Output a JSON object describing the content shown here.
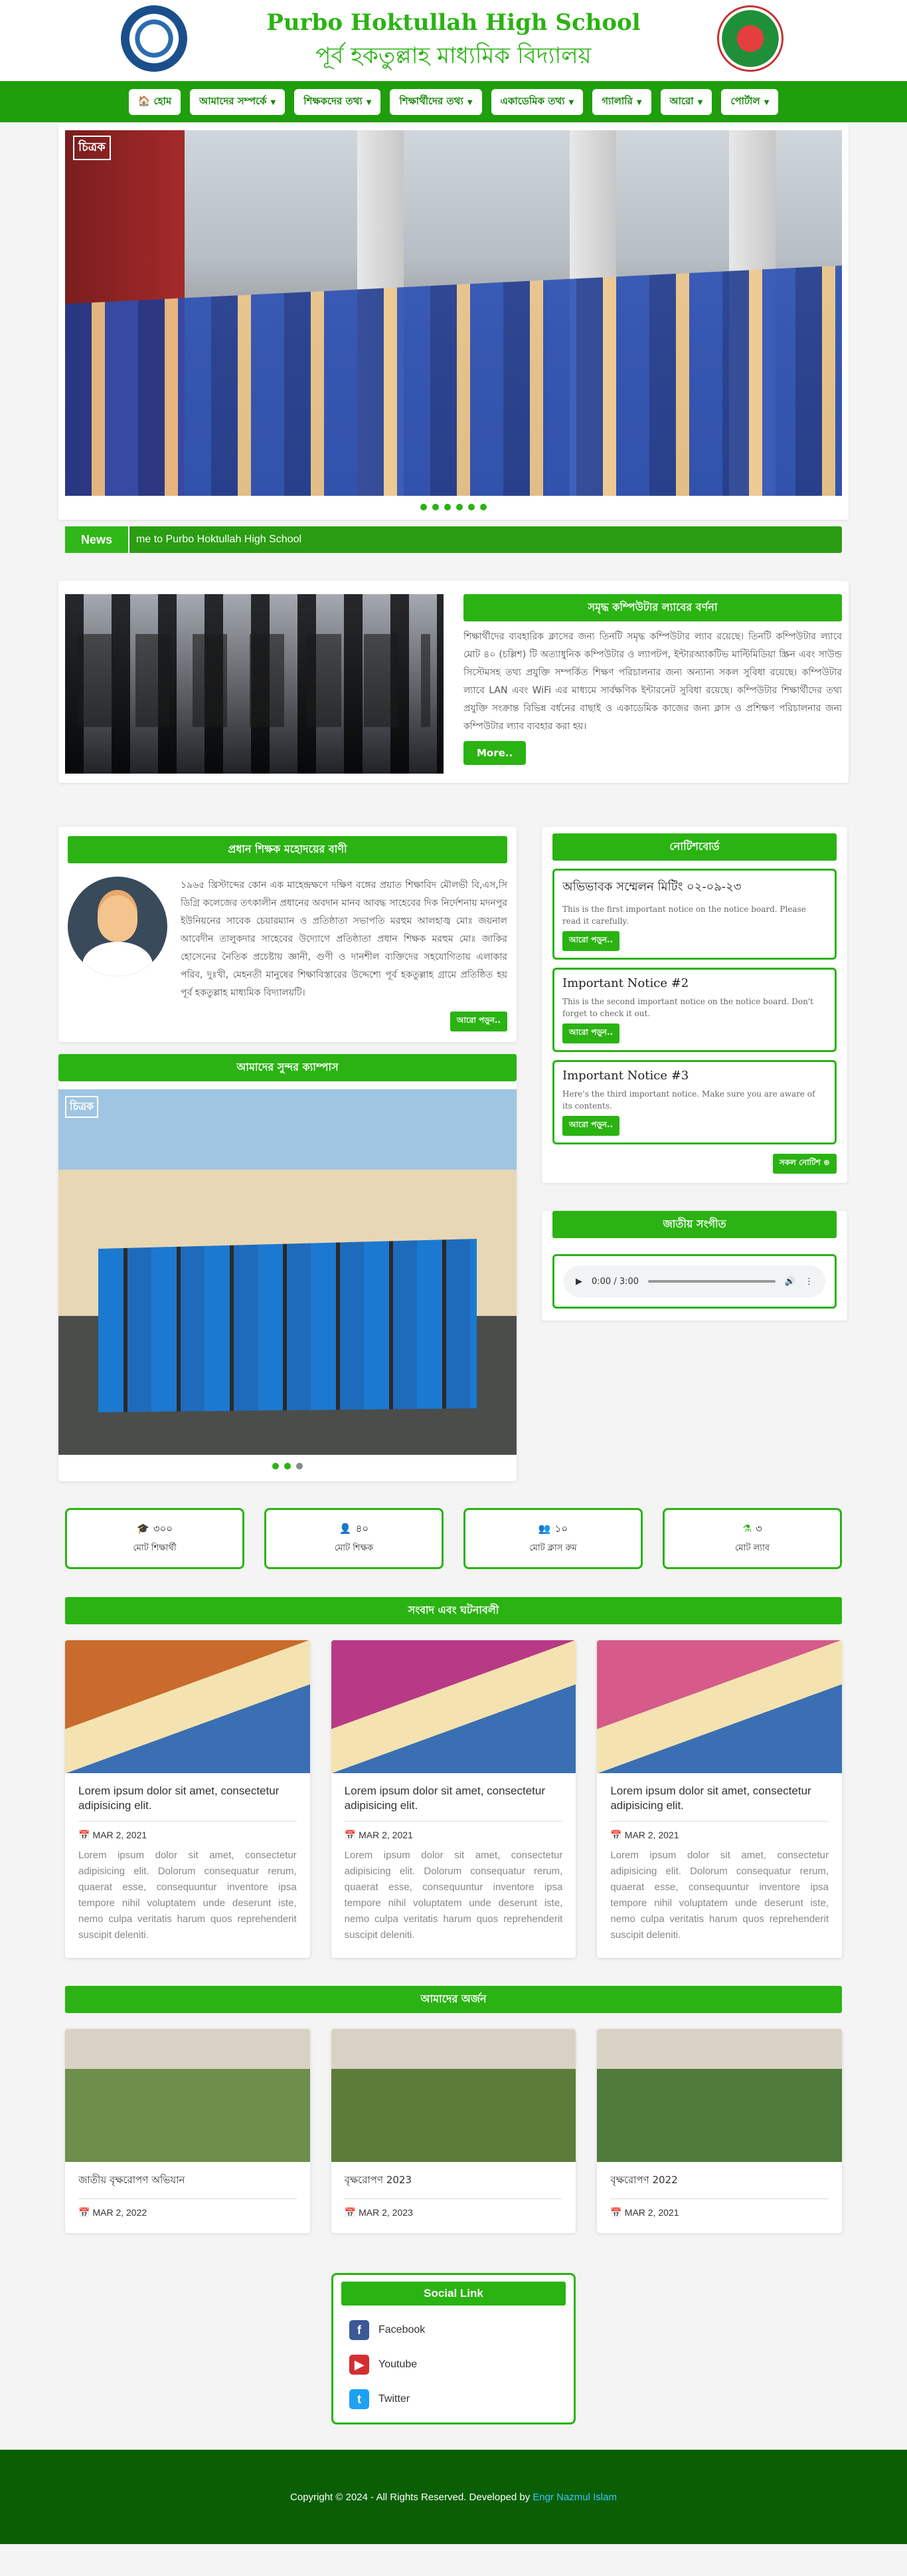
{
  "header": {
    "title_en": "Purbo Hoktullah High School",
    "title_bn": "পূর্ব হকতুল্লাহ মাধ্যমিক বিদ্যালয়"
  },
  "nav": [
    {
      "label": "🏠 হোম",
      "dropdown": false
    },
    {
      "label": "আমাদের সম্পর্কে",
      "dropdown": true
    },
    {
      "label": "শিক্ষকদের তথ্য",
      "dropdown": true
    },
    {
      "label": "শিক্ষার্থীদের তথ্য",
      "dropdown": true
    },
    {
      "label": "একাডেমিক তথ্য",
      "dropdown": true
    },
    {
      "label": "গ্যালারি",
      "dropdown": true
    },
    {
      "label": "আরো",
      "dropdown": true
    },
    {
      "label": "পোর্টাল",
      "dropdown": true
    }
  ],
  "hero": {
    "tag": "চিত্রক"
  },
  "news": {
    "label": "News",
    "text": "me to Purbo Hoktullah High School"
  },
  "lab": {
    "title": "সমৃদ্ধ কম্পিউটার ল্যাবের বর্ণনা",
    "text": "শিক্ষার্থীদের ব্যবহারিক ক্লাসের জন্য তিনটি সমৃদ্ধ কম্পিউটার ল্যাব রয়েছে। তিনটি কম্পিউটার ল্যাবে মোট ৪০ (চল্লিশ) টি অত্যাধুনিক কম্পিউটার ও ল্যাপটপ, ইন্টারঅ্যাকটিভ মাল্টিমিডিয়া স্ক্রিন এবং সাউন্ড সিস্টেমসহ তথ্য প্রযুক্তি সম্পর্কিত শিক্ষণ পরিচালনার জন্য অন্যান্য সকল সুবিধা রয়েছে। কম্পিউটার ল্যাবে LAN এবং WiFi এর মাধ্যমে সার্বক্ষণিক ইন্টারনেট সুবিধা রয়েছে। কম্পিউটার শিক্ষার্থীদের তথ্য প্রযুক্তি সংক্রান্ত বিভিন্ন বর্ধনের বাছাই ও একাডেমিক কাজের জন্য ক্লাস ও প্রশিক্ষণ পরিচালনার জন্য কম্পিউটার ল্যাব ব্যবহার করা হয়।",
    "button": "More.."
  },
  "message": {
    "title": "প্রধান শিক্ষক মহোদয়ের বাণী",
    "text": "১৯৬৫ খ্রিস্টাব্দের কোন এক মাহেন্দ্রক্ষণে দক্ষিণ বঙ্গের প্রয়াত শিক্ষাবিদ মৌলভী বি,এস,সি ডিগ্রি কলেজের তৎকালীন প্রধানের অবদান মানব আবদ্ধ সাহেবের দিক নির্দেশনায় মদনপুর ইউনিয়নের সাবেক চেয়ারম্যান ও প্রতিষ্ঠাতা সভাপতি মরহুম আলহাজ্ব মোঃ জয়নাল আবেদীন তালুকদার সাহেবের উদ্যোগে প্রতিষ্ঠাতা প্রধান শিক্ষক মরহুম মোঃ জাকির হোসেনের নৈতিক প্রচেষ্টায় জ্ঞানী, গুণী ও দানশীল ব্যক্তিদের সহযোগিতায় এলাকার পরিব, দুঃখী, মেহনতী মানুষের শিক্ষাবিস্তারের উদ্দেশ্যে পূর্ব হকতুল্লাহ গ্রামে প্রতিষ্ঠিত হয় পূর্ব হকতুল্লাহ মাধ্যমিক বিদ্যালয়টি।",
    "button": "আরো পড়ুন.."
  },
  "campus": {
    "title": "আমাদের সুন্দর ক্যাম্পাস",
    "tag": "চিত্রক"
  },
  "notice_board": {
    "title": "নোটিশবোর্ড",
    "items": [
      {
        "title": "অভিভাবক সম্মেলন মিটিং ০২-০৯-২৩",
        "desc": "This is the first important notice on the notice board. Please read it carefully.",
        "button": "আরো পড়ুন.."
      },
      {
        "title": "Important Notice #2",
        "desc": "This is the second important notice on the notice board. Don't forget to check it out.",
        "button": "আরো পড়ুন.."
      },
      {
        "title": "Important Notice #3",
        "desc": "Here's the third important notice. Make sure you are aware of its contents.",
        "button": "আরো পড়ুন.."
      }
    ],
    "all_button": "সকল নোটিশ ⊕"
  },
  "anthem": {
    "title": "জাতীয় সংগীত",
    "time": "0:00 / 3:00"
  },
  "stats": [
    {
      "icon": "🎓",
      "value": "৩০০",
      "label": "মোট শিক্ষার্থী"
    },
    {
      "icon": "👤",
      "value": "৪০",
      "label": "মোট শিক্ষক"
    },
    {
      "icon": "👥",
      "value": "১০",
      "label": "মোট ক্লাস রুম"
    },
    {
      "icon": "⚗",
      "value": "৩",
      "label": "মোট ল্যাব"
    }
  ],
  "events": {
    "title": "সংবাদ এবং ঘটনাবলী",
    "items": [
      {
        "title": "Lorem ipsum dolor sit amet, consectetur adipisicing elit.",
        "date": "MAR 2, 2021",
        "desc": "Lorem ipsum dolor sit amet, consectetur adipisicing elit. Dolorum consequatur rerum, quaerat esse, consequuntur inventore ipsa tempore nihil voluptatem unde deserunt iste, nemo culpa veritatis harum quos reprehenderit suscipit deleniti.",
        "color": "#c96b2c"
      },
      {
        "title": "Lorem ipsum dolor sit amet, consectetur adipisicing elit.",
        "date": "MAR 2, 2021",
        "desc": "Lorem ipsum dolor sit amet, consectetur adipisicing elit. Dolorum consequatur rerum, quaerat esse, consequuntur inventore ipsa tempore nihil voluptatem unde deserunt iste, nemo culpa veritatis harum quos reprehenderit suscipit deleniti.",
        "color": "#b83a86"
      },
      {
        "title": "Lorem ipsum dolor sit amet, consectetur adipisicing elit.",
        "date": "MAR 2, 2021",
        "desc": "Lorem ipsum dolor sit amet, consectetur adipisicing elit. Dolorum consequatur rerum, quaerat esse, consequuntur inventore ipsa tempore nihil voluptatem unde deserunt iste, nemo culpa veritatis harum quos reprehenderit suscipit deleniti.",
        "color": "#d65b8a"
      }
    ]
  },
  "achievements": {
    "title": "আমাদের অর্জন",
    "items": [
      {
        "title": "জাতীয় বৃক্ষরোপণ অভিযান",
        "date": "MAR 2, 2022",
        "color": "#6d8f4a"
      },
      {
        "title": "বৃক্ষরোপণ 2023",
        "date": "MAR 2, 2023",
        "color": "#5c7d3a"
      },
      {
        "title": "বৃক্ষরোপণ 2022",
        "date": "MAR 2, 2021",
        "color": "#4f7a3a"
      }
    ]
  },
  "social": {
    "title": "Social Link",
    "items": [
      {
        "name": "Facebook",
        "icon": "f",
        "color": "#3b5998"
      },
      {
        "name": "Youtube",
        "icon": "▶",
        "color": "#d32f2f"
      },
      {
        "name": "Twitter",
        "icon": "t",
        "color": "#1da1f2"
      }
    ]
  },
  "footer": {
    "copyright": "Copyright © 2024 - All Rights Reserved. Developed by",
    "developer": "Engr Nazmul Islam"
  }
}
